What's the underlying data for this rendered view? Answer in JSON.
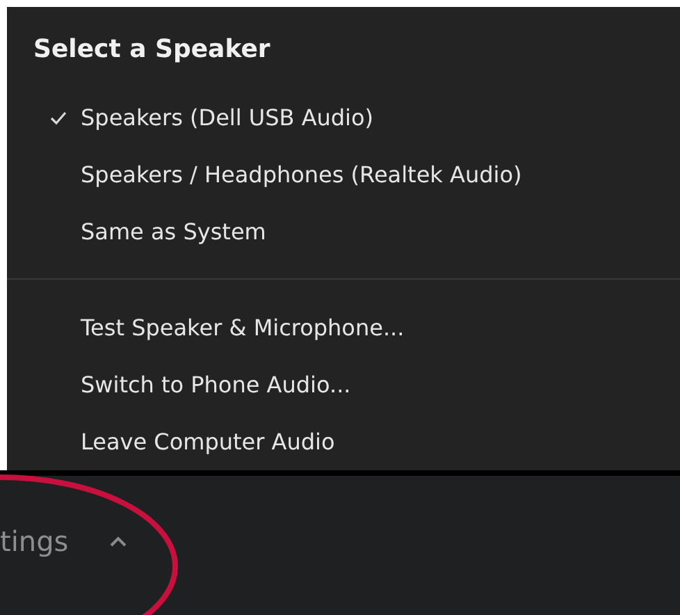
{
  "menu": {
    "title": "Select a Speaker",
    "sections": [
      {
        "items": [
          {
            "label": "Speakers (Dell USB Audio)",
            "selected": true
          },
          {
            "label": "Speakers / Headphones (Realtek Audio)",
            "selected": false
          },
          {
            "label": "Same as System",
            "selected": false
          }
        ]
      },
      {
        "items": [
          {
            "label": "Test Speaker & Microphone..."
          },
          {
            "label": "Switch to Phone Audio..."
          },
          {
            "label": "Leave Computer Audio"
          }
        ]
      }
    ]
  },
  "toolbar": {
    "label": "tings"
  }
}
